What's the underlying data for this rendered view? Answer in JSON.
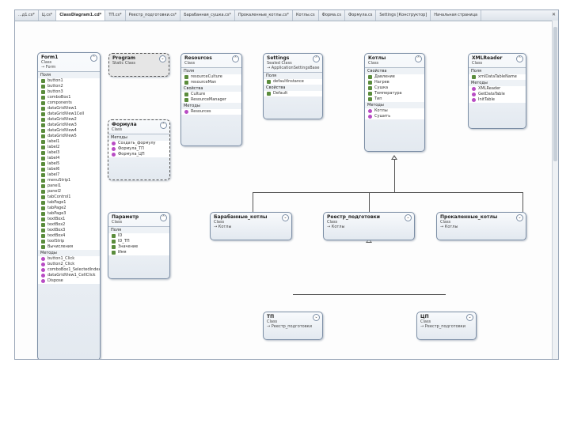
{
  "tabs": [
    {
      "label": "...д1.cs*"
    },
    {
      "label": "Ц.cs*"
    },
    {
      "label": "ClassDiagram1.cd*"
    },
    {
      "label": "ТП.cs*"
    },
    {
      "label": "Реестр_подготовки.cs*"
    },
    {
      "label": "Барабанная_сушка.cs*"
    },
    {
      "label": "Прокаленные_котлы.cs*"
    },
    {
      "label": "Котлы.cs"
    },
    {
      "label": "Форма.cs"
    },
    {
      "label": "Формула.cs"
    },
    {
      "label": "Settings [Конструктор]"
    },
    {
      "label": "Начальная страница"
    }
  ],
  "classes": {
    "form1": {
      "name": "Form1",
      "type": "Class",
      "base": "→ Form",
      "sections": [
        "Поля"
      ],
      "members": [
        "button1",
        "button2",
        "button3",
        "comboBox1",
        "components",
        "dataGridView1",
        "dataGridView1Cell",
        "dataGridView2",
        "dataGridView3",
        "dataGridView4",
        "dataGridView5",
        "label1",
        "label2",
        "label3",
        "label4",
        "label5",
        "label6",
        "label7",
        "menuStrip1",
        "panel1",
        "panel2",
        "tabControl1",
        "tabPage1",
        "tabPage2",
        "tabPage3",
        "textBox1",
        "textBox2",
        "textBox3",
        "textBox4",
        "toolStrip",
        "Вычисления"
      ],
      "methods_label": "Методы",
      "methods": [
        "button1_Click",
        "button2_Click",
        "comboBox1_SelectedIndexChanged",
        "dataGridView1_CellClick",
        "Dispose"
      ]
    },
    "program": {
      "name": "Program",
      "type": "Static Class"
    },
    "resources": {
      "name": "Resources",
      "type": "Class",
      "fields_label": "Поля",
      "fields": [
        "resourceCulture",
        "resourceMan"
      ],
      "props_label": "Свойства",
      "props": [
        "Culture",
        "ResourceManager"
      ],
      "methods_label": "Методы",
      "methods": [
        "Resources"
      ]
    },
    "settings": {
      "name": "Settings",
      "type": "Sealed Class",
      "base": "→ ApplicationSettingsBase",
      "fields_label": "Поля",
      "fields": [
        "defaultInstance"
      ],
      "props_label": "Свойства",
      "props": [
        "Default"
      ]
    },
    "kotly": {
      "name": "Котлы",
      "type": "Class",
      "props_label": "Свойства",
      "props": [
        "Давление",
        "Нагрев",
        "Сушка",
        "Температура",
        "Тип"
      ],
      "methods_label": "Методы",
      "methods": [
        "Котлы",
        "Сушить"
      ]
    },
    "xmlreader": {
      "name": "XMLReader",
      "type": "Class",
      "fields_label": "Поля",
      "fields": [
        "xmlDataTableName"
      ],
      "methods_label": "Методы",
      "methods": [
        "XMLReader",
        "GetDataTable",
        "InitTable"
      ]
    },
    "formula": {
      "name": "Формула",
      "type": "Class",
      "methods_label": "Методы",
      "methods": [
        "Создать_формулу",
        "Формула_ТП",
        "Формула_ЦП"
      ]
    },
    "parametr": {
      "name": "Параметр",
      "type": "Class",
      "fields_label": "Поля",
      "fields": [
        "ID",
        "ID_ТП",
        "Значение",
        "Имя"
      ]
    },
    "drum": {
      "name": "Барабанные_котлы",
      "type": "Class",
      "base": "→ Котлы"
    },
    "registry": {
      "name": "Реестр_подготовки",
      "type": "Class",
      "base": "→ Котлы"
    },
    "calcined": {
      "name": "Прокаленные_котлы",
      "type": "Class",
      "base": "→ Котлы"
    },
    "tp": {
      "name": "ТП",
      "type": "Class",
      "base": "→ Реестр_подготовки"
    },
    "cp": {
      "name": "ЦП",
      "type": "Class",
      "base": "→ Реестр_подготовки"
    }
  },
  "colors": {
    "border": "#7d8fa6",
    "method_icon": "#b84cc4",
    "field_icon": "#3a78c2"
  }
}
